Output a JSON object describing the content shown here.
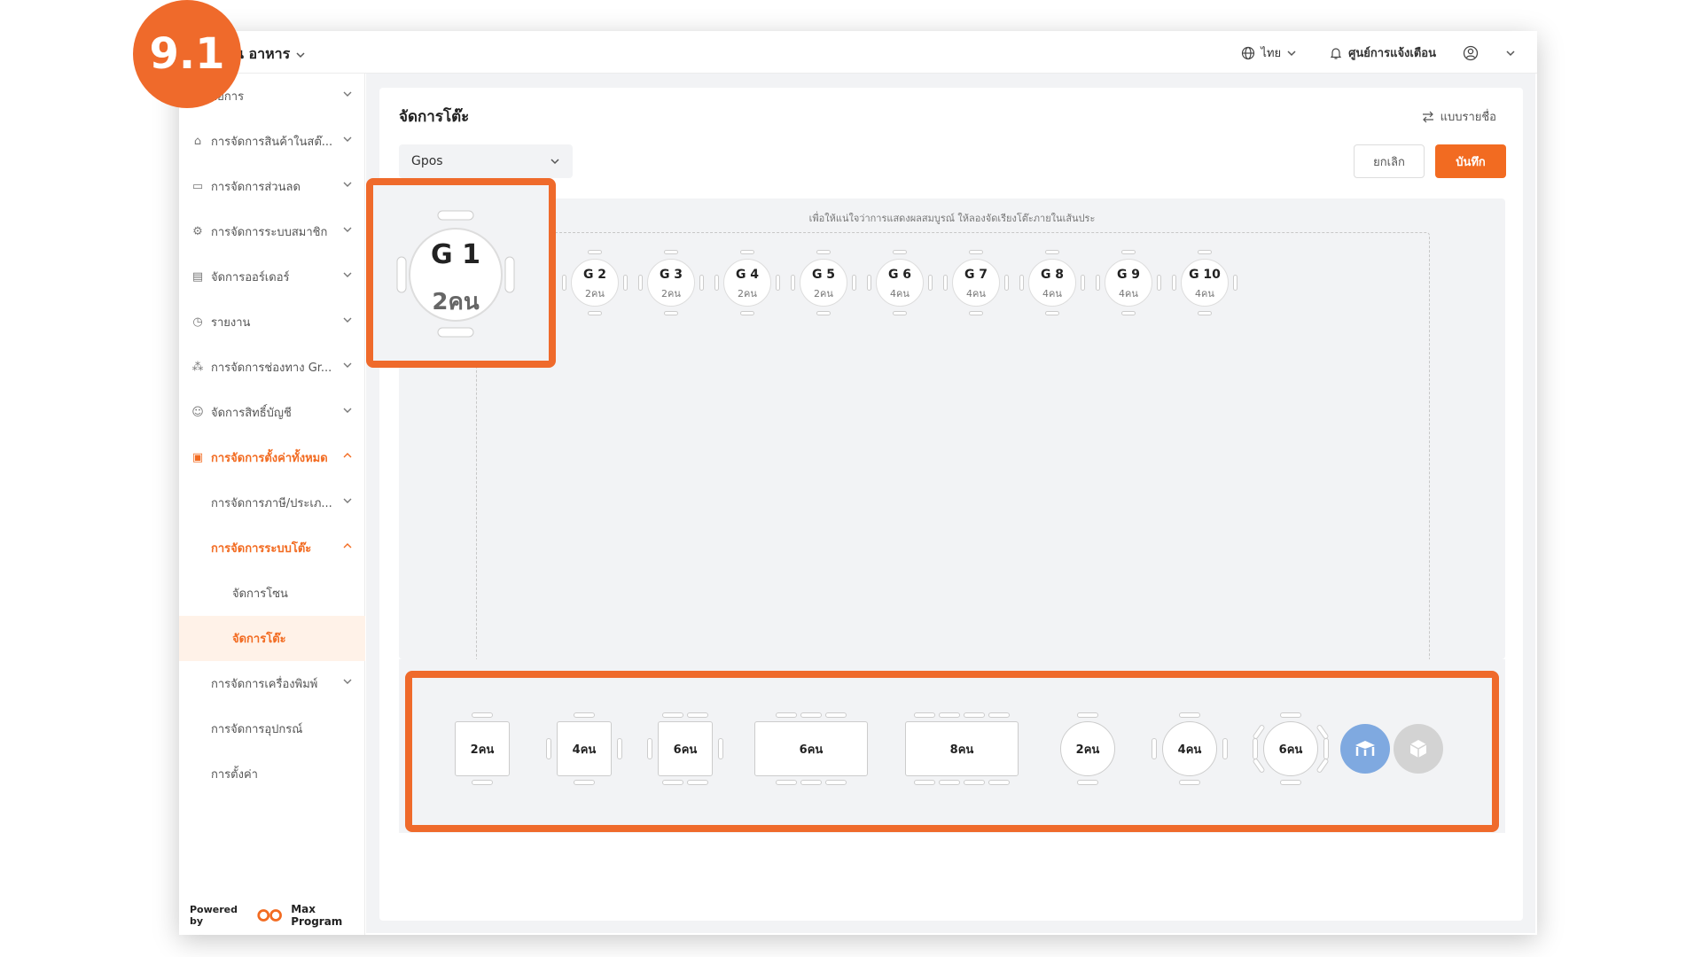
{
  "tutorial": {
    "step": "9.1"
  },
  "topbar": {
    "brand": "น อาหาร",
    "language": "ไทย",
    "notifications": "ศูนย์การแจ้งเตือน"
  },
  "sidebar": {
    "items": [
      {
        "label": "ายการ"
      },
      {
        "label": "การจัดการสินค้าในสต๊..."
      },
      {
        "label": "การจัดการส่วนลด"
      },
      {
        "label": "การจัดการระบบสมาชิก"
      },
      {
        "label": "จัดการออร์เดอร์"
      },
      {
        "label": "รายงาน"
      },
      {
        "label": "การจัดการช่องทาง Gr..."
      },
      {
        "label": "จัดการสิทธิ์บัญชี"
      },
      {
        "label": "การจัดการตั้งค่าทั้งหมด"
      },
      {
        "label": "การจัดการภาษี/ประเภ..."
      },
      {
        "label": "การจัดการระบบโต๊ะ"
      },
      {
        "label": "จัดการโซน"
      },
      {
        "label": "จัดการโต๊ะ"
      },
      {
        "label": "การจัดการเครื่องพิมพ์"
      },
      {
        "label": "การจัดการอุปกรณ์"
      },
      {
        "label": "การตั้งค่า"
      }
    ],
    "powered_by": "Powered by",
    "logo_text": "Max Program"
  },
  "main": {
    "title": "จัดการโต๊ะ",
    "view_toggle": "แบบรายชื่อ",
    "zone_select": "Gpos",
    "cancel": "ยกเลิก",
    "save": "บันทึก",
    "hint": "เพื่อให้แน่ใจว่าการแสดงผลสมบูรณ์ ให้ลองจัดเรียงโต๊ะภายในเส้นประ"
  },
  "tables": [
    {
      "name": "G 1",
      "capacity": "2คน"
    },
    {
      "name": "G 2",
      "capacity": "2คน"
    },
    {
      "name": "G 3",
      "capacity": "2คน"
    },
    {
      "name": "G 4",
      "capacity": "2คน"
    },
    {
      "name": "G 5",
      "capacity": "2คน"
    },
    {
      "name": "G 6",
      "capacity": "4คน"
    },
    {
      "name": "G 7",
      "capacity": "4คน"
    },
    {
      "name": "G 8",
      "capacity": "4คน"
    },
    {
      "name": "G 9",
      "capacity": "4คน"
    },
    {
      "name": "G 10",
      "capacity": "4คน"
    }
  ],
  "palette": [
    {
      "label": "2คน",
      "shape": "square"
    },
    {
      "label": "4คน",
      "shape": "square"
    },
    {
      "label": "6คน",
      "shape": "square"
    },
    {
      "label": "6คน",
      "shape": "rectangle"
    },
    {
      "label": "8คน",
      "shape": "rectangle"
    },
    {
      "label": "2คน",
      "shape": "round"
    },
    {
      "label": "4คน",
      "shape": "round"
    },
    {
      "label": "6คน",
      "shape": "round"
    }
  ],
  "palette_icons": [
    {
      "icon": "table-icon",
      "color": "#7fa9e0"
    },
    {
      "icon": "cube-icon",
      "color": "#d3d3d3"
    }
  ],
  "colors": {
    "accent": "#f26b21",
    "highlight": "#ef6a2b"
  }
}
